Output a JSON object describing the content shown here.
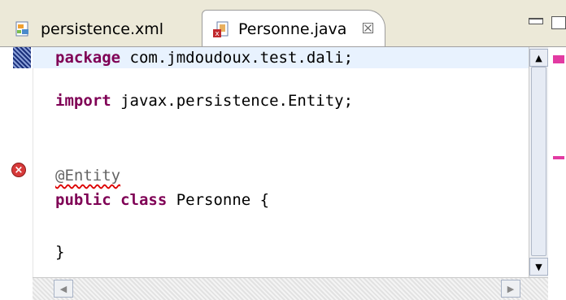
{
  "tabs": [
    {
      "label": "persistence.xml",
      "icon": "xml-file-icon",
      "active": false
    },
    {
      "label": "Personne.java",
      "icon": "java-file-error-icon",
      "active": true,
      "close_glyph": "☒"
    }
  ],
  "editor": {
    "lines": [
      {
        "parts": [
          {
            "t": "package",
            "kw": true
          },
          {
            "t": " com.jmdoudoux.test.dali;"
          }
        ]
      },
      {
        "parts": [
          {
            "t": "import",
            "kw": true
          },
          {
            "t": " javax.persistence.Entity;"
          }
        ]
      },
      {
        "parts": [
          {
            "t": "@Entity",
            "ann": true
          }
        ]
      },
      {
        "parts": [
          {
            "t": "public",
            "kw": true
          },
          {
            "t": " "
          },
          {
            "t": "class",
            "kw": true
          },
          {
            "t": " Personne {"
          }
        ]
      },
      {
        "parts": [
          {
            "t": "}"
          }
        ]
      }
    ],
    "error_glyph": "×"
  },
  "colors": {
    "keyword": "#7f0055",
    "current_line": "#e8f2fe",
    "error_marker": "#d73a3a",
    "overview_marker": "#e23aa2"
  }
}
